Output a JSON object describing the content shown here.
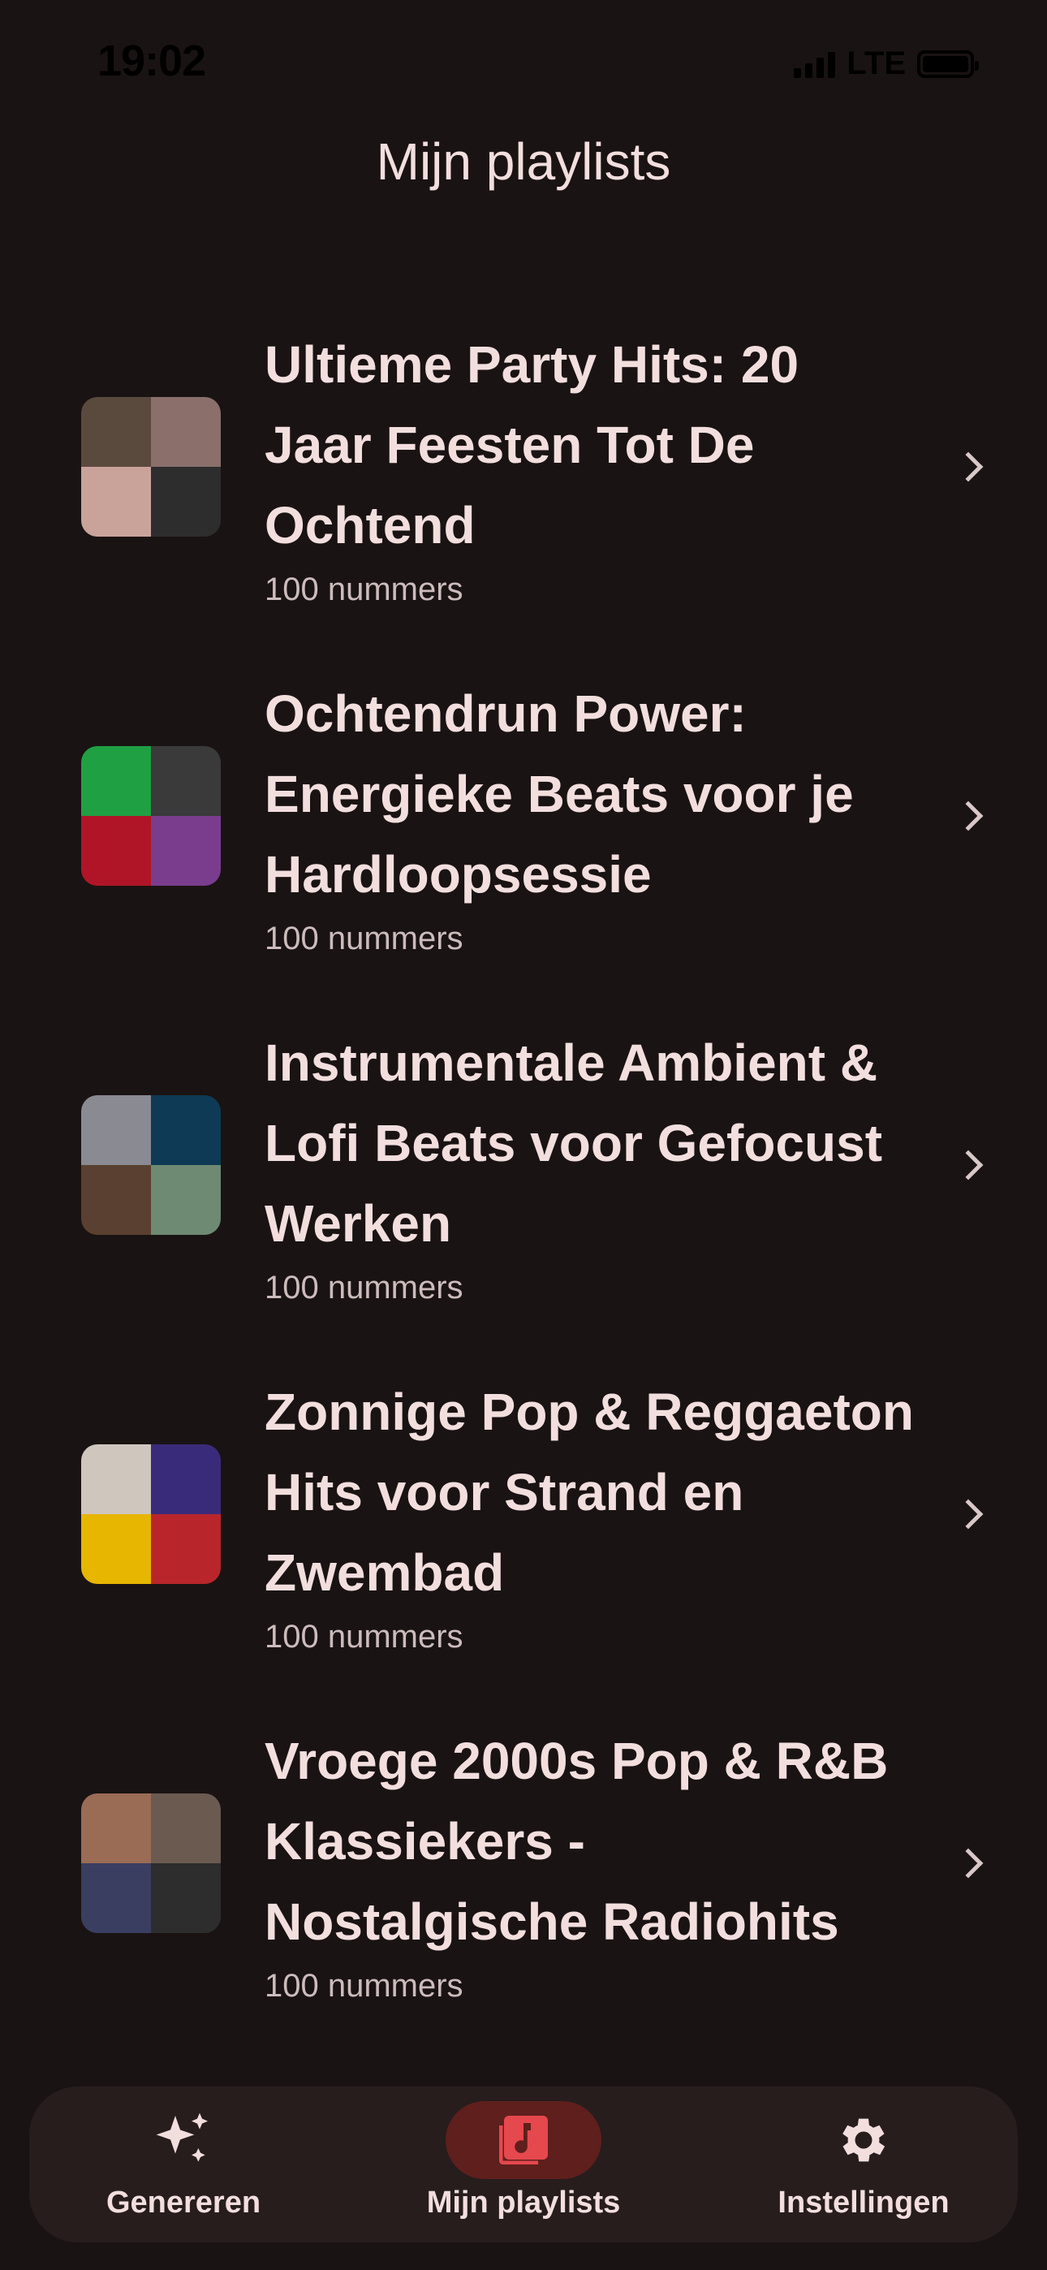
{
  "status_bar": {
    "time": "19:02",
    "network": "LTE"
  },
  "page_title": "Mijn playlists",
  "playlists": [
    {
      "title": "Ultieme Party Hits: 20 Jaar Feesten Tot De Ochtend",
      "count": "100 nummers",
      "cover_colors": [
        "#5a4a3e",
        "#8a6f6a",
        "#c9a39a",
        "#2d2d2d"
      ]
    },
    {
      "title": "Ochtendrun Power: Energieke Beats voor je Hardloopsessie",
      "count": "100 nummers",
      "cover_colors": [
        "#1fa043",
        "#3a3a3a",
        "#b01527",
        "#7a3d8d"
      ]
    },
    {
      "title": "Instrumentale Ambient & Lofi Beats voor Gefocust Werken",
      "count": "100 nummers",
      "cover_colors": [
        "#8a8a92",
        "#0e3a55",
        "#5a4030",
        "#6e8a72"
      ]
    },
    {
      "title": "Zonnige Pop & Reggaeton Hits voor Strand en Zwembad",
      "count": "100 nummers",
      "cover_colors": [
        "#cfc6bd",
        "#3a2b7a",
        "#e6b600",
        "#b8262b"
      ]
    },
    {
      "title": "Vroege 2000s Pop & R&B Klassiekers - Nostalgische Radiohits",
      "count": "100 nummers",
      "cover_colors": [
        "#9a6c55",
        "#6a5a50",
        "#3a3e60",
        "#2d2d2d"
      ]
    }
  ],
  "bottom_nav": [
    {
      "label": "Genereren",
      "icon": "sparkle-icon",
      "active": false
    },
    {
      "label": "Mijn playlists",
      "icon": "music-library-icon",
      "active": true
    },
    {
      "label": "Instellingen",
      "icon": "gear-icon",
      "active": false
    }
  ],
  "colors": {
    "background": "#1a1313",
    "nav_background": "#271d1d",
    "active_pill": "#5e1f1d",
    "accent": "#e5484d",
    "text": "#f3dede"
  }
}
